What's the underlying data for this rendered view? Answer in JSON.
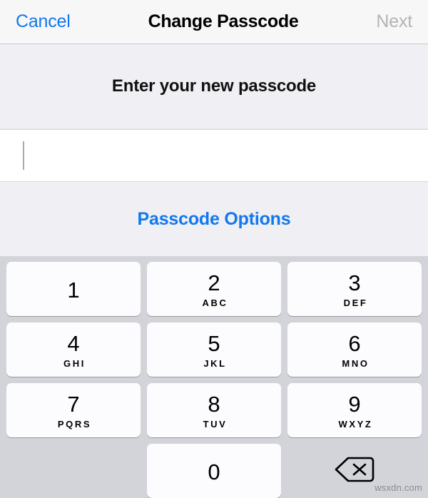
{
  "navbar": {
    "cancel_label": "Cancel",
    "title": "Change Passcode",
    "next_label": "Next"
  },
  "prompt": {
    "text": "Enter your new passcode"
  },
  "passcode_field": {
    "value": "",
    "placeholder": ""
  },
  "options": {
    "label": "Passcode Options"
  },
  "keypad": {
    "keys": [
      {
        "digit": "1",
        "letters": ""
      },
      {
        "digit": "2",
        "letters": "ABC"
      },
      {
        "digit": "3",
        "letters": "DEF"
      },
      {
        "digit": "4",
        "letters": "GHI"
      },
      {
        "digit": "5",
        "letters": "JKL"
      },
      {
        "digit": "6",
        "letters": "MNO"
      },
      {
        "digit": "7",
        "letters": "PQRS"
      },
      {
        "digit": "8",
        "letters": "TUV"
      },
      {
        "digit": "9",
        "letters": "WXYZ"
      },
      {
        "digit": "0",
        "letters": ""
      }
    ],
    "delete_icon": "delete-backward-icon"
  },
  "watermark": {
    "text": "wsxdn.com"
  },
  "colors": {
    "accent_blue": "#1178ef",
    "disabled_gray": "#b4b4b8",
    "keypad_background": "#d2d4da",
    "key_face": "#fcfcfe",
    "panel_background": "#f0eff4"
  }
}
